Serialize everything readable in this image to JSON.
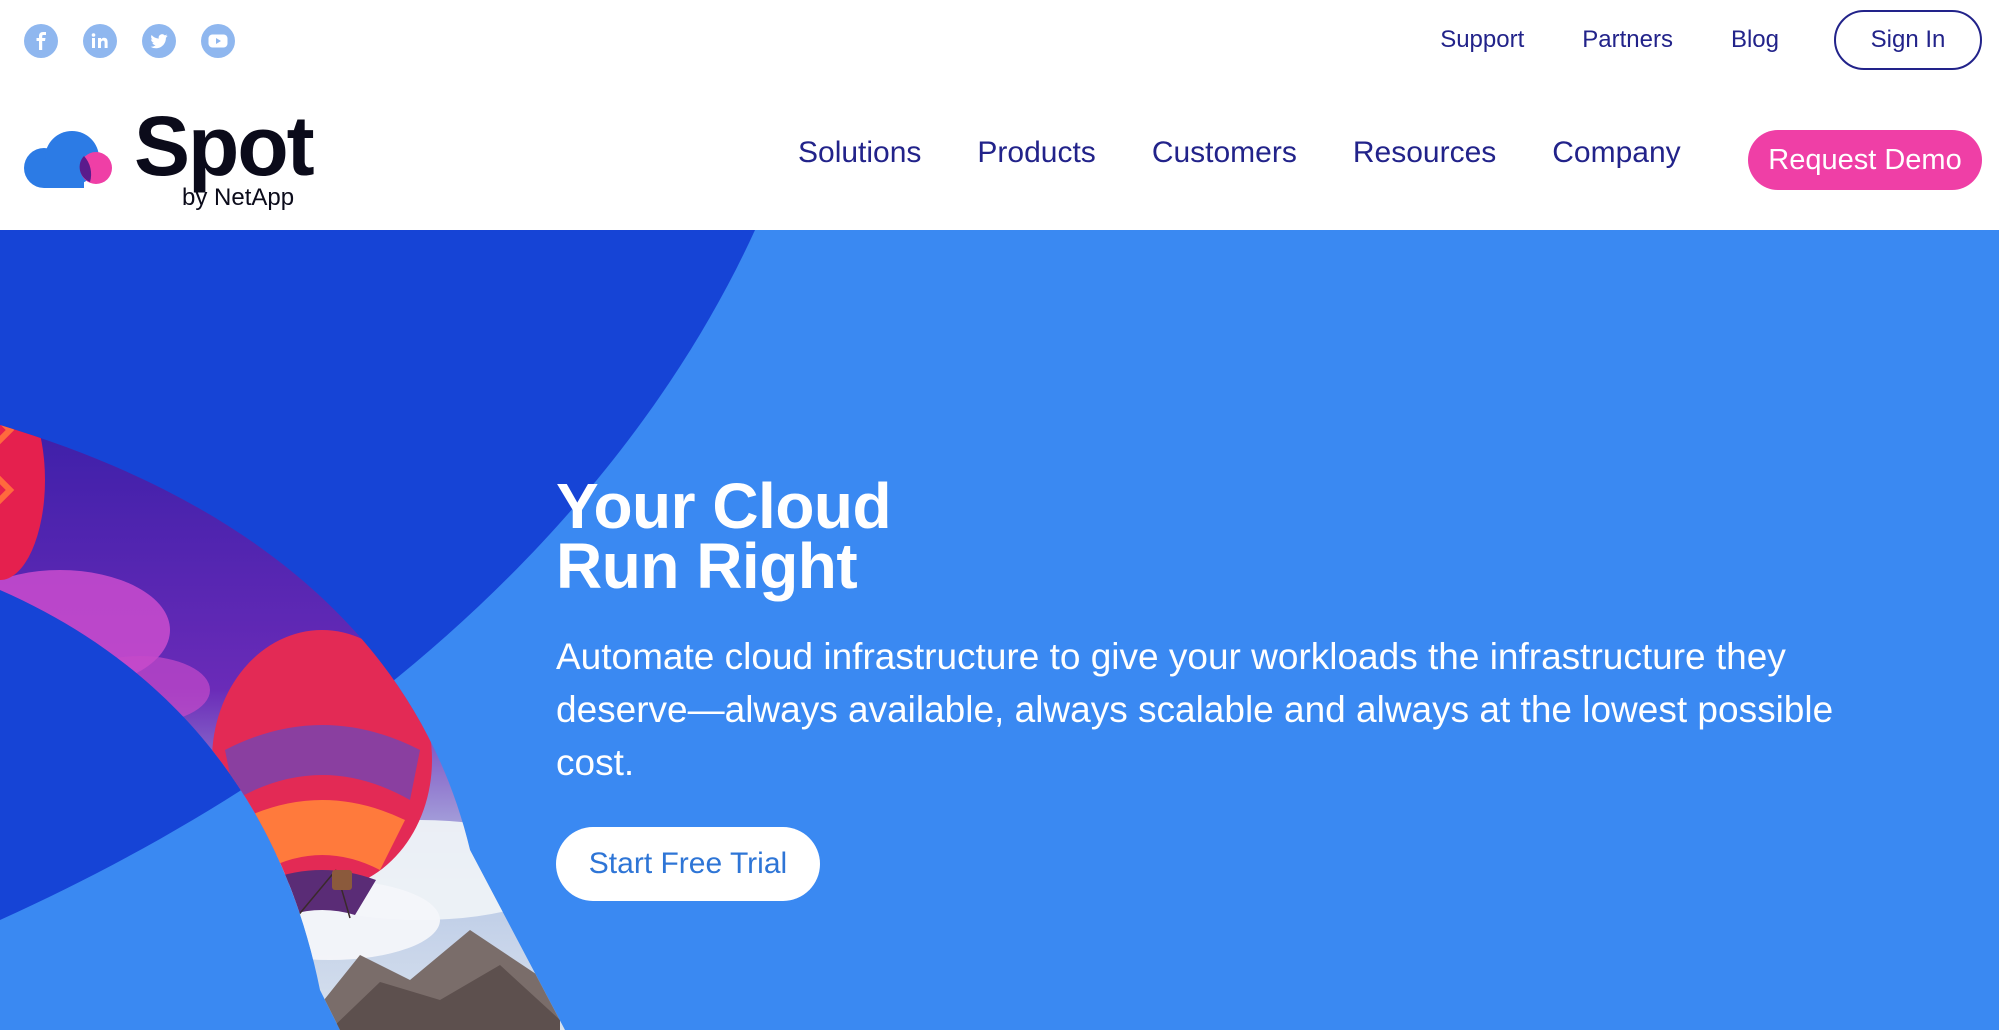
{
  "social": {
    "icons": [
      "facebook-icon",
      "linkedin-icon",
      "twitter-icon",
      "youtube-icon"
    ],
    "icon_color": "#8fb7ef"
  },
  "utility_nav": {
    "links": [
      "Support",
      "Partners",
      "Blog"
    ],
    "sign_in_label": "Sign In"
  },
  "brand": {
    "name": "Spot",
    "tagline": "by NetApp"
  },
  "main_nav": {
    "items": [
      "Solutions",
      "Products",
      "Customers",
      "Resources",
      "Company"
    ],
    "cta_label": "Request Demo"
  },
  "hero": {
    "title_line_1": "Your Cloud",
    "title_line_2": "Run Right",
    "description": "Automate cloud infrastructure to give your workloads the infrastructure they deserve—always available, always scalable and always at the lowest possible cost.",
    "cta_label": "Start Free Trial"
  },
  "colors": {
    "nav_text": "#22238a",
    "accent_pink": "#ef3fa6",
    "hero_blue": "#3a89f2",
    "hero_dark_blue": "#1644d6",
    "button_text_blue": "#2e75d6"
  }
}
